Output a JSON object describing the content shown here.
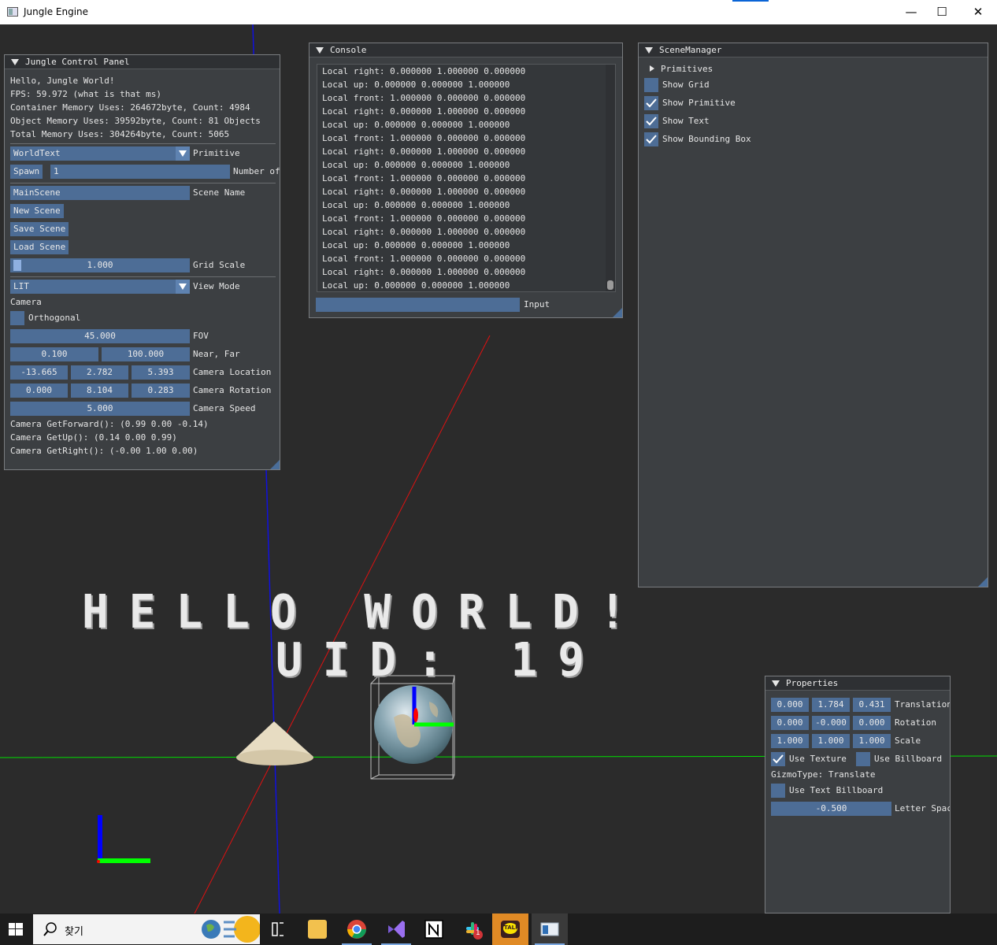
{
  "window": {
    "title": "Jungle Engine",
    "minimize_glyph": "—",
    "maximize_glyph": "☐",
    "close_glyph": "✕"
  },
  "world": {
    "line1": "HELLO WORLD!",
    "line2": "UID: 19"
  },
  "control_panel": {
    "title": "Jungle Control Panel",
    "greeting": "Hello, Jungle World!",
    "fps": "FPS: 59.972 (what is that ms)",
    "container_mem": "Container Memory Uses: 264672byte, Count: 4984",
    "object_mem": "Object Memory Uses: 39592byte, Count: 81 Objects",
    "total_mem": "Total Memory Uses: 304264byte, Count: 5065",
    "primitive_value": "WorldText",
    "primitive_label": "Primitive",
    "spawn_button": "Spawn",
    "spawn_count": "1",
    "spawn_count_label": "Number of",
    "scene_name_value": "MainScene",
    "scene_name_label": "Scene Name",
    "new_scene": "New Scene",
    "save_scene": "Save Scene",
    "load_scene": "Load Scene",
    "grid_scale_value": "1.000",
    "grid_scale_label": "Grid Scale",
    "view_mode_value": "LIT",
    "view_mode_label": "View Mode",
    "camera_header": "Camera",
    "orthogonal_label": "Orthogonal",
    "fov_value": "45.000",
    "fov_label": "FOV",
    "near_value": "0.100",
    "far_value": "100.000",
    "near_far_label": "Near, Far",
    "loc_x": "-13.665",
    "loc_y": "2.782",
    "loc_z": "5.393",
    "loc_label": "Camera Location",
    "rot_x": "0.000",
    "rot_y": "8.104",
    "rot_z": "0.283",
    "rot_label": "Camera Rotation",
    "speed_value": "5.000",
    "speed_label": "Camera Speed",
    "forward": "Camera GetForward(): (0.99 0.00 -0.14)",
    "up": "Camera GetUp(): (0.14 0.00 0.99)",
    "right": "Camera GetRight(): (-0.00 1.00 0.00)"
  },
  "console": {
    "title": "Console",
    "lines": [
      "Local right: 0.000000 1.000000 0.000000",
      "Local up: 0.000000 0.000000 1.000000",
      "Local front: 1.000000 0.000000 0.000000",
      "Local right: 0.000000 1.000000 0.000000",
      "Local up: 0.000000 0.000000 1.000000",
      "Local front: 1.000000 0.000000 0.000000",
      "Local right: 0.000000 1.000000 0.000000",
      "Local up: 0.000000 0.000000 1.000000",
      "Local front: 1.000000 0.000000 0.000000",
      "Local right: 0.000000 1.000000 0.000000",
      "Local up: 0.000000 0.000000 1.000000",
      "Local front: 1.000000 0.000000 0.000000",
      "Local right: 0.000000 1.000000 0.000000",
      "Local up: 0.000000 0.000000 1.000000",
      "Local front: 1.000000 0.000000 0.000000",
      "Local right: 0.000000 1.000000 0.000000",
      "Local up: 0.000000 0.000000 1.000000"
    ],
    "input_label": "Input",
    "input_value": ""
  },
  "scene_manager": {
    "title": "SceneManager",
    "primitives": "Primitives",
    "show_grid": "Show Grid",
    "show_primitive": "Show Primitive",
    "show_text": "Show Text",
    "show_bounding_box": "Show Bounding Box",
    "checks": {
      "grid": false,
      "primitive": true,
      "text": true,
      "bbox": true
    }
  },
  "properties": {
    "title": "Properties",
    "tx": "0.000",
    "ty": "1.784",
    "tz": "0.431",
    "t_label": "Translation",
    "rx": "0.000",
    "ry": "-0.000",
    "rz": "0.000",
    "r_label": "Rotation",
    "sx": "1.000",
    "sy": "1.000",
    "sz": "1.000",
    "s_label": "Scale",
    "use_texture": "Use Texture",
    "use_billboard": "Use Billboard",
    "gizmo_type": "GizmoType: Translate",
    "use_text_billboard": "Use Text Billboard",
    "letter_spacing_value": "-0.500",
    "letter_spacing_label": "Letter Spacing"
  },
  "taskbar": {
    "search_text": "찾기",
    "slack_badge": "1",
    "kakao_label": "TALK"
  },
  "colors": {
    "panel_bg": "#3c3f42",
    "frame_bg": "#4d6d96",
    "axis_x": "#ff2020",
    "axis_y": "#00ff00",
    "axis_z": "#0000ff"
  }
}
